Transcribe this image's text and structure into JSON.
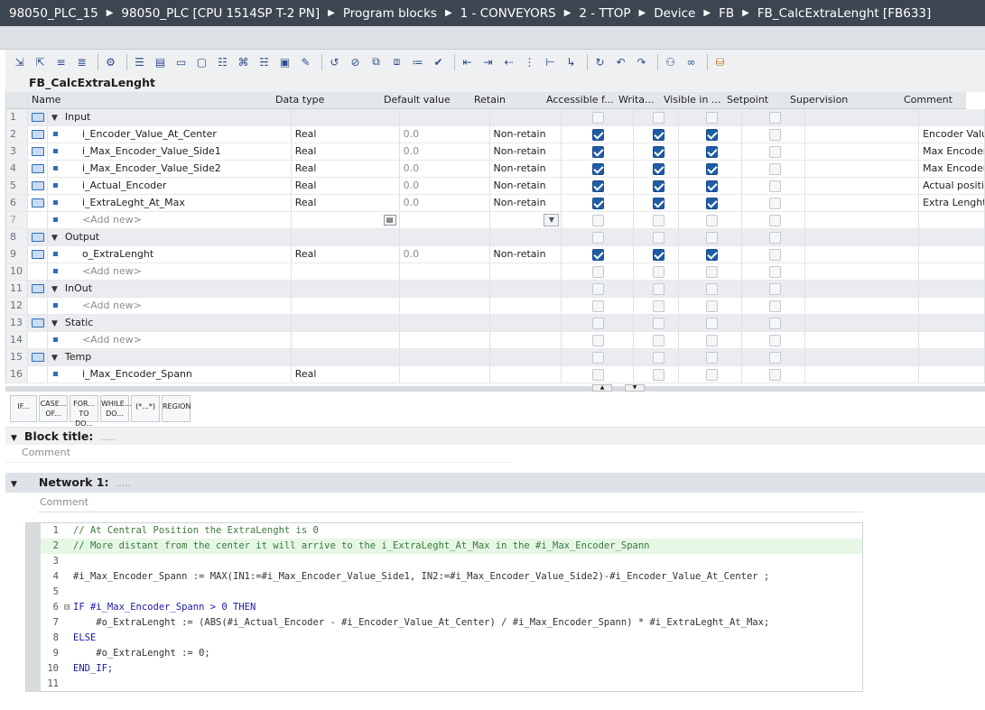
{
  "breadcrumb": [
    "98050_PLC_15",
    "98050_PLC [CPU 1514SP T-2 PN]",
    "Program blocks",
    "1 - CONVEYORS",
    "2 - TTOP",
    "Device",
    "FB",
    "FB_CalcExtraLenght [FB633]"
  ],
  "block_name": "FB_CalcExtraLenght",
  "columns": {
    "name": "Name",
    "data_type": "Data type",
    "default_value": "Default value",
    "retain": "Retain",
    "accessible": "Accessible f...",
    "writable": "Writa...",
    "visible": "Visible in ...",
    "setpoint": "Setpoint",
    "supervision": "Supervision",
    "comment": "Comment"
  },
  "rows": [
    {
      "num": "1",
      "kind": "section",
      "name": "Input"
    },
    {
      "num": "2",
      "kind": "var",
      "name": "i_Encoder_Value_At_Center",
      "type": "Real",
      "default": "0.0",
      "retain": "Non-retain",
      "comment": "Encoder Valu"
    },
    {
      "num": "3",
      "kind": "var",
      "name": "i_Max_Encoder_Value_Side1",
      "type": "Real",
      "default": "0.0",
      "retain": "Non-retain",
      "comment": "Max Encoder"
    },
    {
      "num": "4",
      "kind": "var",
      "name": "i_Max_Encoder_Value_Side2",
      "type": "Real",
      "default": "0.0",
      "retain": "Non-retain",
      "comment": "Max Encoder"
    },
    {
      "num": "5",
      "kind": "var",
      "name": "i_Actual_Encoder",
      "type": "Real",
      "default": "0.0",
      "retain": "Non-retain",
      "comment": "Actual positic"
    },
    {
      "num": "6",
      "kind": "var",
      "name": "i_ExtraLeght_At_Max",
      "type": "Real",
      "default": "0.0",
      "retain": "Non-retain",
      "comment": "Extra Lenght"
    },
    {
      "num": "7",
      "kind": "add",
      "name": "<Add new>"
    },
    {
      "num": "8",
      "kind": "section",
      "name": "Output"
    },
    {
      "num": "9",
      "kind": "var",
      "name": "o_ExtraLenght",
      "type": "Real",
      "default": "0.0",
      "retain": "Non-retain",
      "comment": ""
    },
    {
      "num": "10",
      "kind": "add",
      "name": "<Add new>"
    },
    {
      "num": "11",
      "kind": "section",
      "name": "InOut"
    },
    {
      "num": "12",
      "kind": "add",
      "name": "<Add new>"
    },
    {
      "num": "13",
      "kind": "section",
      "name": "Static"
    },
    {
      "num": "14",
      "kind": "add",
      "name": "<Add new>"
    },
    {
      "num": "15",
      "kind": "section",
      "name": "Temp"
    },
    {
      "num": "16",
      "kind": "temp",
      "name": "i_Max_Encoder_Spann",
      "type": "Real"
    }
  ],
  "scl_buttons": [
    {
      "line1": "IF...",
      "line2": ""
    },
    {
      "line1": "CASE...",
      "line2": "OF..."
    },
    {
      "line1": "FOR...",
      "line2": "TO DO..."
    },
    {
      "line1": "WHILE...",
      "line2": "DO..."
    },
    {
      "line1": "(*...*)",
      "line2": ""
    },
    {
      "line1": "REGION",
      "line2": ""
    }
  ],
  "block_title_label": "Block title:",
  "block_title_dots": ".....",
  "block_comment": "Comment",
  "network_label": "Network 1:",
  "network_dots": ".....",
  "network_comment": "Comment",
  "code_lines": [
    "// At Central Position the ExtraLenght is 0",
    "// More distant from the center it will arrive to the i_ExtraLeght_At_Max in the #i_Max_Encoder_Spann",
    "",
    "#i_Max_Encoder_Spann := MAX(IN1:=#i_Max_Encoder_Value_Side1, IN2:=#i_Max_Encoder_Value_Side2)-#i_Encoder_Value_At_Center ;",
    "",
    "IF #i_Max_Encoder_Spann > 0 THEN",
    "    #o_ExtraLenght := (ABS(#i_Actual_Encoder - #i_Encoder_Value_At_Center) / #i_Max_Encoder_Spann) * #i_ExtraLeght_At_Max;",
    "ELSE",
    "    #o_ExtraLenght := 0;",
    "END_IF;",
    ""
  ]
}
